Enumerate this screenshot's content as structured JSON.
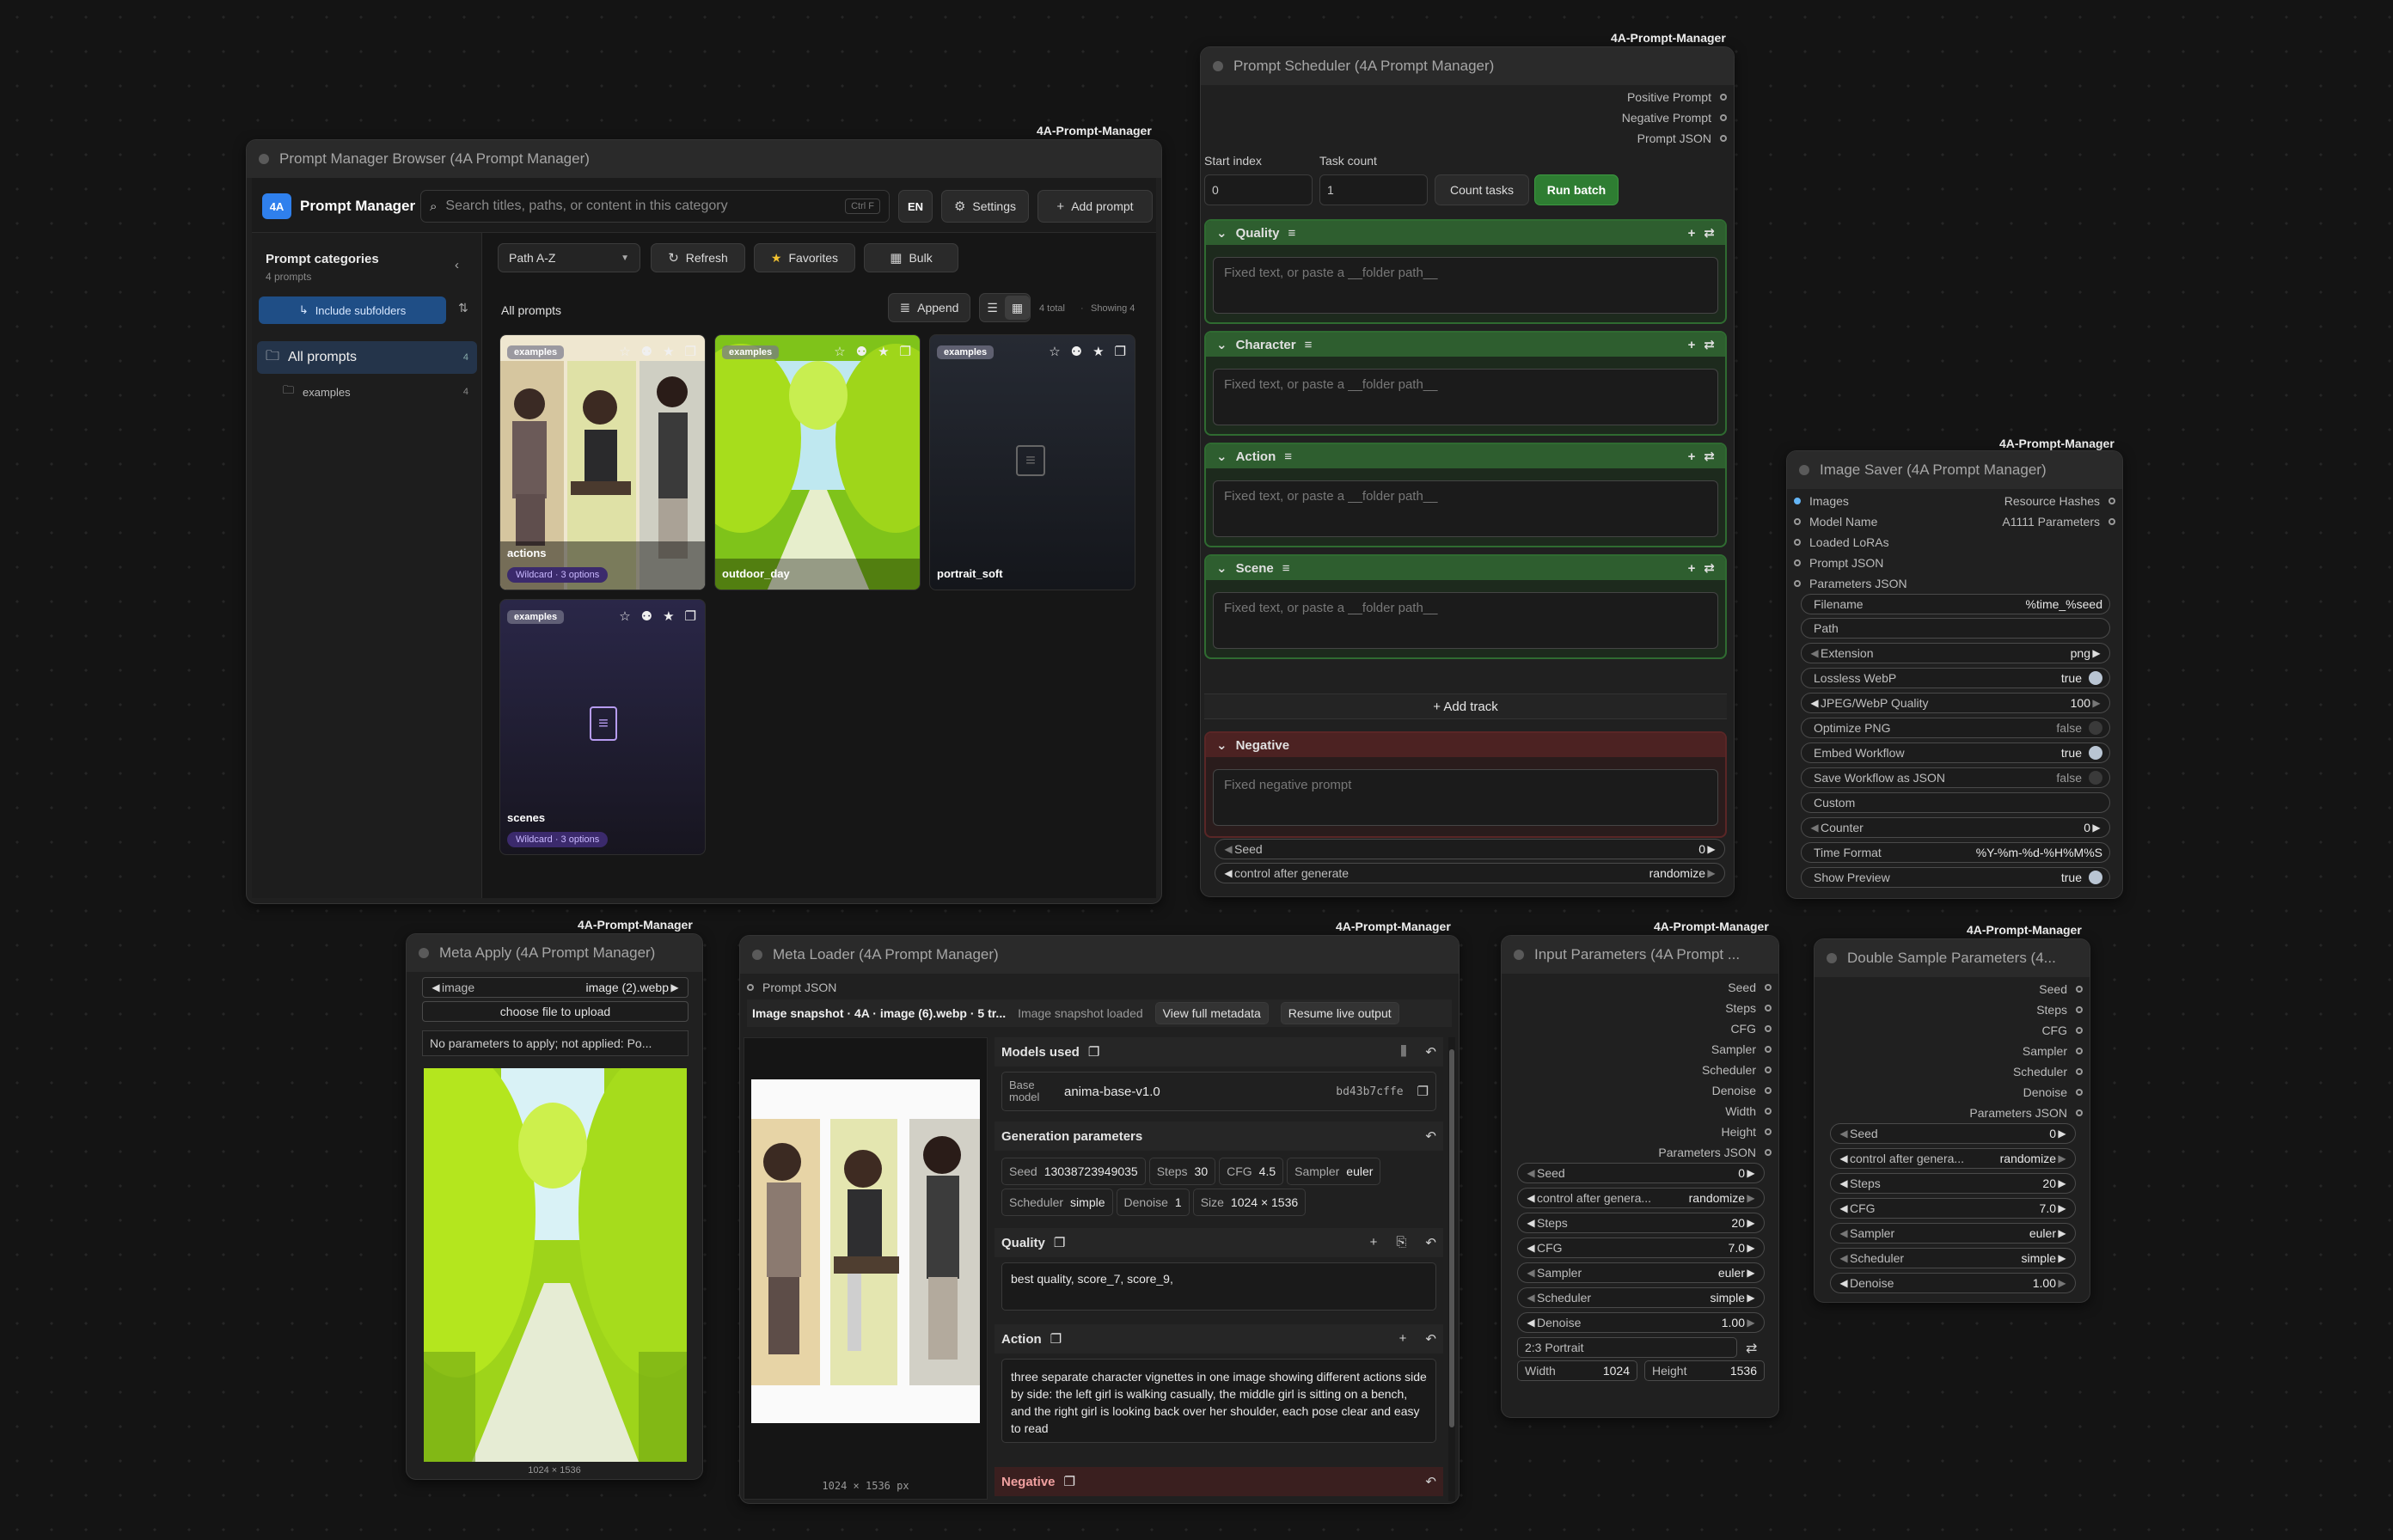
{
  "brand": {
    "tag": "4A-Prompt-Manager",
    "accent": "#2f80ed",
    "green": "#2e7d32",
    "red_track": "#5a2626"
  },
  "browser": {
    "title": "Prompt Manager Browser (4A Prompt Manager)",
    "logo": "4A",
    "app_name": "Prompt Manager",
    "search_placeholder": "Search titles, paths, or content in this category",
    "search_kbd": "Ctrl F",
    "lang": "EN",
    "settings": "Settings",
    "add_prompt": "Add prompt",
    "categories_title": "Prompt categories",
    "categories_count": "4 prompts",
    "include_subfolders": "Include subfolders",
    "tree": [
      {
        "label": "All prompts",
        "count": "4"
      },
      {
        "label": "examples",
        "count": "4"
      }
    ],
    "sort": "Path A-Z",
    "refresh": "Refresh",
    "favorites": "Favorites",
    "bulk": "Bulk",
    "breadcrumb": "All prompts",
    "append": "Append",
    "total": "4 total",
    "showing": "Showing 4",
    "cards": [
      {
        "folder": "examples",
        "name": "actions",
        "badge": "Wildcard · 3 options"
      },
      {
        "folder": "examples",
        "name": "outdoor_day",
        "badge": ""
      },
      {
        "folder": "examples",
        "name": "portrait_soft",
        "badge": ""
      },
      {
        "folder": "examples",
        "name": "scenes",
        "badge": "Wildcard · 3 options"
      }
    ]
  },
  "scheduler": {
    "title": "Prompt Scheduler (4A Prompt Manager)",
    "outputs": [
      "Positive Prompt",
      "Negative Prompt",
      "Prompt JSON"
    ],
    "start_label": "Start index",
    "start_value": "0",
    "task_label": "Task count",
    "task_value": "1",
    "count_tasks": "Count tasks",
    "run_batch": "Run batch",
    "tracks": [
      "Quality",
      "Character",
      "Action",
      "Scene"
    ],
    "track_placeholder": "Fixed text, or paste a __folder path__",
    "add_track": "+ Add track",
    "negative": "Negative",
    "negative_placeholder": "Fixed negative prompt",
    "seed_label": "Seed",
    "seed_value": "0",
    "cag_label": "control after generate",
    "cag_value": "randomize"
  },
  "saver": {
    "title": "Image Saver (4A Prompt Manager)",
    "inputs": [
      "Images",
      "Model Name",
      "Loaded LoRAs",
      "Prompt JSON",
      "Parameters JSON"
    ],
    "outputs": [
      "Resource Hashes",
      "A1111 Parameters"
    ],
    "widgets": [
      {
        "label": "Filename",
        "value": "%time_%seed"
      },
      {
        "label": "Path",
        "value": ""
      },
      {
        "label": "Extension",
        "value": "png"
      },
      {
        "label": "Lossless WebP",
        "value": "true"
      },
      {
        "label": "JPEG/WebP Quality",
        "value": "100"
      },
      {
        "label": "Optimize PNG",
        "value": "false"
      },
      {
        "label": "Embed Workflow",
        "value": "true"
      },
      {
        "label": "Save Workflow as JSON",
        "value": "false"
      },
      {
        "label": "Custom",
        "value": ""
      },
      {
        "label": "Counter",
        "value": "0"
      },
      {
        "label": "Time Format",
        "value": "%Y-%m-%d-%H%M%S"
      },
      {
        "label": "Show Preview",
        "value": "true"
      }
    ]
  },
  "apply": {
    "title": "Meta Apply (4A Prompt Manager)",
    "image_label": "image",
    "image_value": "image (2).webp",
    "upload": "choose file to upload",
    "status": "No parameters to apply; not applied: Po...",
    "size": "1024 × 1536"
  },
  "loader": {
    "title": "Meta Loader (4A Prompt Manager)",
    "output": "Prompt JSON",
    "snapshot": "Image snapshot · 4A · image (6).webp · 5 tr...",
    "loaded": "Image snapshot loaded",
    "view_meta": "View full metadata",
    "resume": "Resume live output",
    "img_size": "1024 × 1536 px",
    "models_used": "Models used",
    "base_label": "Base model",
    "base_value": "anima-base-v1.0",
    "base_hash": "bd43b7cffe",
    "gen_params": "Generation parameters",
    "params": [
      {
        "k": "Seed",
        "v": "13038723949035"
      },
      {
        "k": "Steps",
        "v": "30"
      },
      {
        "k": "CFG",
        "v": "4.5"
      },
      {
        "k": "Sampler",
        "v": "euler"
      },
      {
        "k": "Scheduler",
        "v": "simple"
      },
      {
        "k": "Denoise",
        "v": "1"
      },
      {
        "k": "Size",
        "v": "1024 × 1536"
      }
    ],
    "quality": "Quality",
    "quality_text": "best quality, score_7, score_9,",
    "action": "Action",
    "action_text": "three separate character vignettes in one image showing different actions side by side: the left girl is walking casually, the middle girl is sitting on a bench, and the right girl is looking back over her shoulder, each pose clear and easy to read",
    "negative": "Negative"
  },
  "input_params": {
    "title": "Input Parameters (4A Prompt ...",
    "outputs": [
      "Seed",
      "Steps",
      "CFG",
      "Sampler",
      "Scheduler",
      "Denoise",
      "Width",
      "Height",
      "Parameters JSON"
    ],
    "widgets": [
      {
        "label": "Seed",
        "value": "0"
      },
      {
        "label": "control after genera...",
        "value": "randomize"
      },
      {
        "label": "Steps",
        "value": "20"
      },
      {
        "label": "CFG",
        "value": "7.0"
      },
      {
        "label": "Sampler",
        "value": "euler"
      },
      {
        "label": "Scheduler",
        "value": "simple"
      },
      {
        "label": "Denoise",
        "value": "1.00"
      }
    ],
    "aspect": "2:3 Portrait",
    "width_label": "Width",
    "width_value": "1024",
    "height_label": "Height",
    "height_value": "1536"
  },
  "double": {
    "title": "Double Sample Parameters (4...",
    "outputs": [
      "Seed",
      "Steps",
      "CFG",
      "Sampler",
      "Scheduler",
      "Denoise",
      "Parameters JSON"
    ],
    "widgets": [
      {
        "label": "Seed",
        "value": "0"
      },
      {
        "label": "control after genera...",
        "value": "randomize"
      },
      {
        "label": "Steps",
        "value": "20"
      },
      {
        "label": "CFG",
        "value": "7.0"
      },
      {
        "label": "Sampler",
        "value": "euler"
      },
      {
        "label": "Scheduler",
        "value": "simple"
      },
      {
        "label": "Denoise",
        "value": "1.00"
      }
    ]
  }
}
